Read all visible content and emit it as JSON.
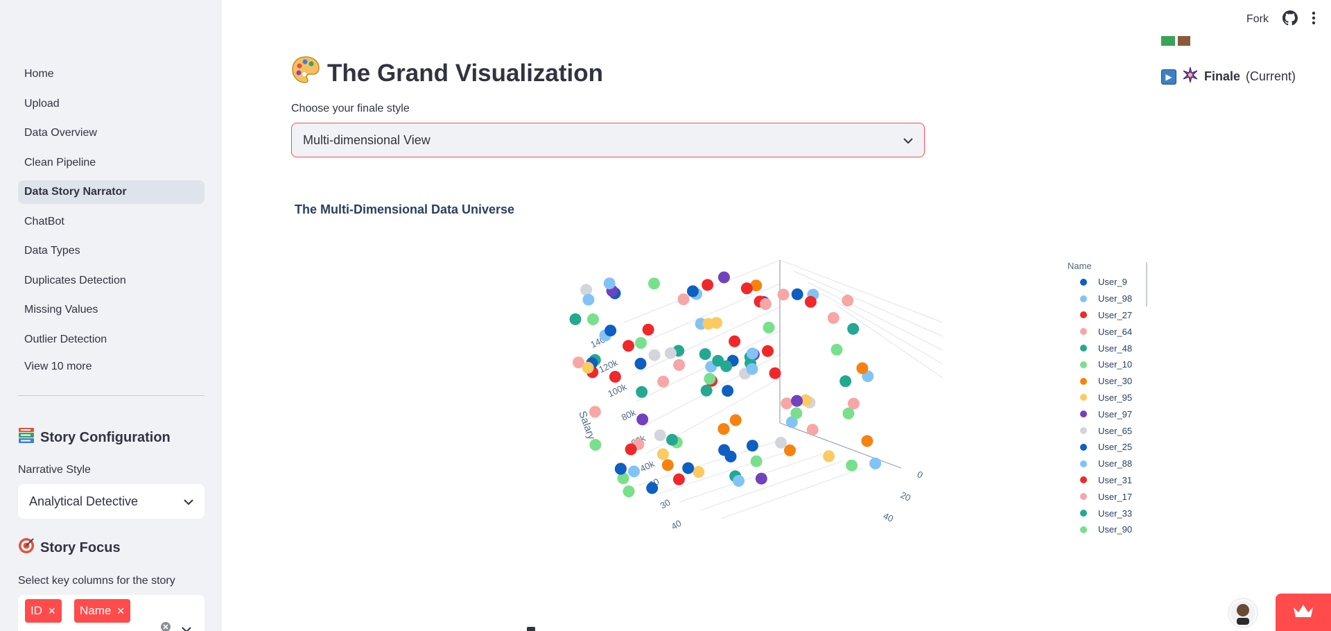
{
  "sidebar": {
    "nav": [
      {
        "label": "Home"
      },
      {
        "label": "Upload"
      },
      {
        "label": "Data Overview"
      },
      {
        "label": "Clean Pipeline"
      },
      {
        "label": "Data Story Narrator",
        "active": true
      },
      {
        "label": "ChatBot"
      },
      {
        "label": "Data Types"
      },
      {
        "label": "Duplicates Detection"
      },
      {
        "label": "Missing Values"
      },
      {
        "label": "Outlier Detection"
      }
    ],
    "view_more": "View 10 more",
    "story_config": {
      "icon": "books-icon",
      "heading": "Story Configuration",
      "narrative_label": "Narrative Style",
      "narrative_value": "Analytical Detective"
    },
    "story_focus": {
      "icon": "target-icon",
      "heading": "Story Focus",
      "columns_label": "Select key columns for the story",
      "tags": [
        "ID",
        "Name"
      ]
    }
  },
  "header": {
    "fork": "Fork"
  },
  "main": {
    "title_icon": "🎨",
    "title": "The Grand Visualization",
    "choose_label": "Choose your finale style",
    "finale_value": "Multi-dimensional View",
    "chart_title": "The Multi-Dimensional Data Universe",
    "progress": {
      "finale_label": "Finale",
      "current": "(Current)"
    }
  },
  "colors": {
    "accent": "#ff4b4b",
    "sidebar_bg": "#f0f2f6"
  },
  "chart_data": {
    "type": "scatter",
    "subtype": "scatter3d",
    "title": "The Multi-Dimensional Data Universe",
    "axis_y_title": "Salary",
    "axis_y_ticks": [
      "40k",
      "60k",
      "80k",
      "100k",
      "120k",
      "140k"
    ],
    "axis_x_ticks": [
      "20",
      "30",
      "40"
    ],
    "axis_z_ticks": [
      "0",
      "20",
      "40"
    ],
    "legend_title": "Name",
    "legend": [
      {
        "name": "User_9",
        "color": "#0d5fc2"
      },
      {
        "name": "User_98",
        "color": "#82c3f5"
      },
      {
        "name": "User_27",
        "color": "#f0282a"
      },
      {
        "name": "User_64",
        "color": "#f7a6a6"
      },
      {
        "name": "User_48",
        "color": "#25a891"
      },
      {
        "name": "User_10",
        "color": "#78e08c"
      },
      {
        "name": "User_30",
        "color": "#f8820f"
      },
      {
        "name": "User_95",
        "color": "#fbcb61"
      },
      {
        "name": "User_97",
        "color": "#7141bf"
      },
      {
        "name": "User_65",
        "color": "#d3d5dc"
      },
      {
        "name": "User_25",
        "color": "#0d5fc2"
      },
      {
        "name": "User_88",
        "color": "#82c3f5"
      },
      {
        "name": "User_31",
        "color": "#f0282a"
      },
      {
        "name": "User_17",
        "color": "#f7a6a6"
      },
      {
        "name": "User_33",
        "color": "#25a891"
      },
      {
        "name": "User_90",
        "color": "#78e08c"
      }
    ]
  }
}
